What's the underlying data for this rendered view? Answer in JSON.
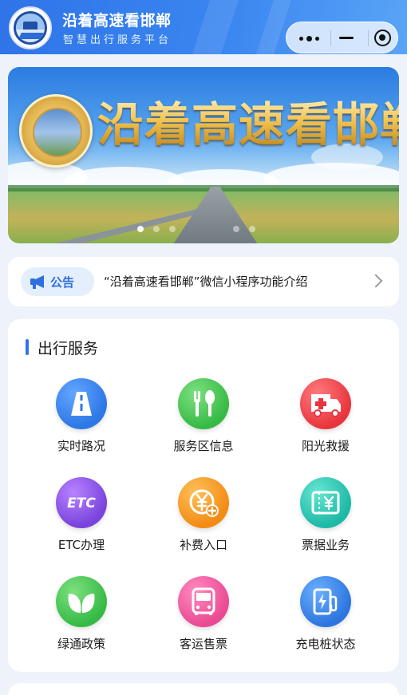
{
  "header": {
    "title": "沿着高速看邯郸",
    "subtitle": "智慧出行服务平台",
    "logo_icon": "expressway-emblem-icon",
    "capsule": {
      "more_icon": "more-dots-icon",
      "minimize_icon": "minimize-icon",
      "close_icon": "close-target-icon"
    }
  },
  "banner": {
    "title": "沿着高速看邯郸",
    "emblem_icon": "expressway-badge-icon",
    "slides_total": 5,
    "active_slide": 1
  },
  "notice": {
    "tag_label": "公告",
    "tag_icon": "megaphone-icon",
    "text": "“沿着高速看邯郸”微信小程序功能介绍",
    "arrow_icon": "chevron-right-icon"
  },
  "services": {
    "title": "出行服务",
    "items": [
      {
        "label": "实时路况",
        "icon": "road-icon",
        "color": "#2d77e6"
      },
      {
        "label": "服务区信息",
        "icon": "fork-spoon-icon",
        "color": "#36ba45"
      },
      {
        "label": "阳光救援",
        "icon": "ambulance-icon",
        "color": "#e8353d"
      },
      {
        "label": "ETC办理",
        "icon": "etc-icon",
        "color": "#7a43dc"
      },
      {
        "label": "补费入口",
        "icon": "yuan-add-icon",
        "color": "#f38b14"
      },
      {
        "label": "票据业务",
        "icon": "ticket-yuan-icon",
        "color": "#1cb9a6"
      },
      {
        "label": "绿通政策",
        "icon": "leaf-icon",
        "color": "#36ba45"
      },
      {
        "label": "客运售票",
        "icon": "bus-icon",
        "color": "#ea4a93"
      },
      {
        "label": "充电桩状态",
        "icon": "charging-station-icon",
        "color": "#2d74df"
      }
    ],
    "etc_icon_text": "ETC"
  },
  "colors": {
    "header_blue": "#3a86f0",
    "accent": "#2f74e8",
    "page_bg": "#eef3fb"
  }
}
